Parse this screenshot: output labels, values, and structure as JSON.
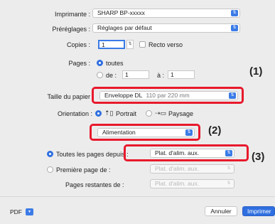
{
  "printer": {
    "label": "Imprimante :",
    "value": "SHARP BP-xxxxx"
  },
  "presets": {
    "label": "Préréglages :",
    "value": "Réglages par défaut"
  },
  "copies": {
    "label": "Copies :",
    "value": "1",
    "duplex_label": "Recto verso"
  },
  "pages": {
    "label": "Pages :",
    "all_label": "toutes",
    "from_label": "de :",
    "from_value": "1",
    "to_label": "à :",
    "to_value": "1"
  },
  "paper_size": {
    "label": "Taille du papier",
    "value": "Enveloppe DL",
    "detail": "110 par 220 mm"
  },
  "orientation": {
    "label": "Orientation :",
    "portrait": "Portrait",
    "landscape": "Paysage"
  },
  "section": {
    "value": "Alimentation"
  },
  "feed": {
    "all_pages_label": "Toutes les pages depuis :",
    "all_pages_value": "Plat. d'alim. aux.",
    "first_page_label": "Première page de :",
    "first_page_value": "Plat. d'alim. aux.",
    "remaining_label": "Pages restantes de :",
    "remaining_value": "Plat. d'alim. aux."
  },
  "callouts": {
    "c1": "(1)",
    "c2": "(2)",
    "c3": "(3)"
  },
  "footer": {
    "pdf_label": "PDF",
    "cancel_label": "Annuler",
    "print_label": "Imprimer"
  },
  "colors": {
    "accent": "#3b7be6",
    "highlight": "#e8192c",
    "background": "#ececec"
  }
}
